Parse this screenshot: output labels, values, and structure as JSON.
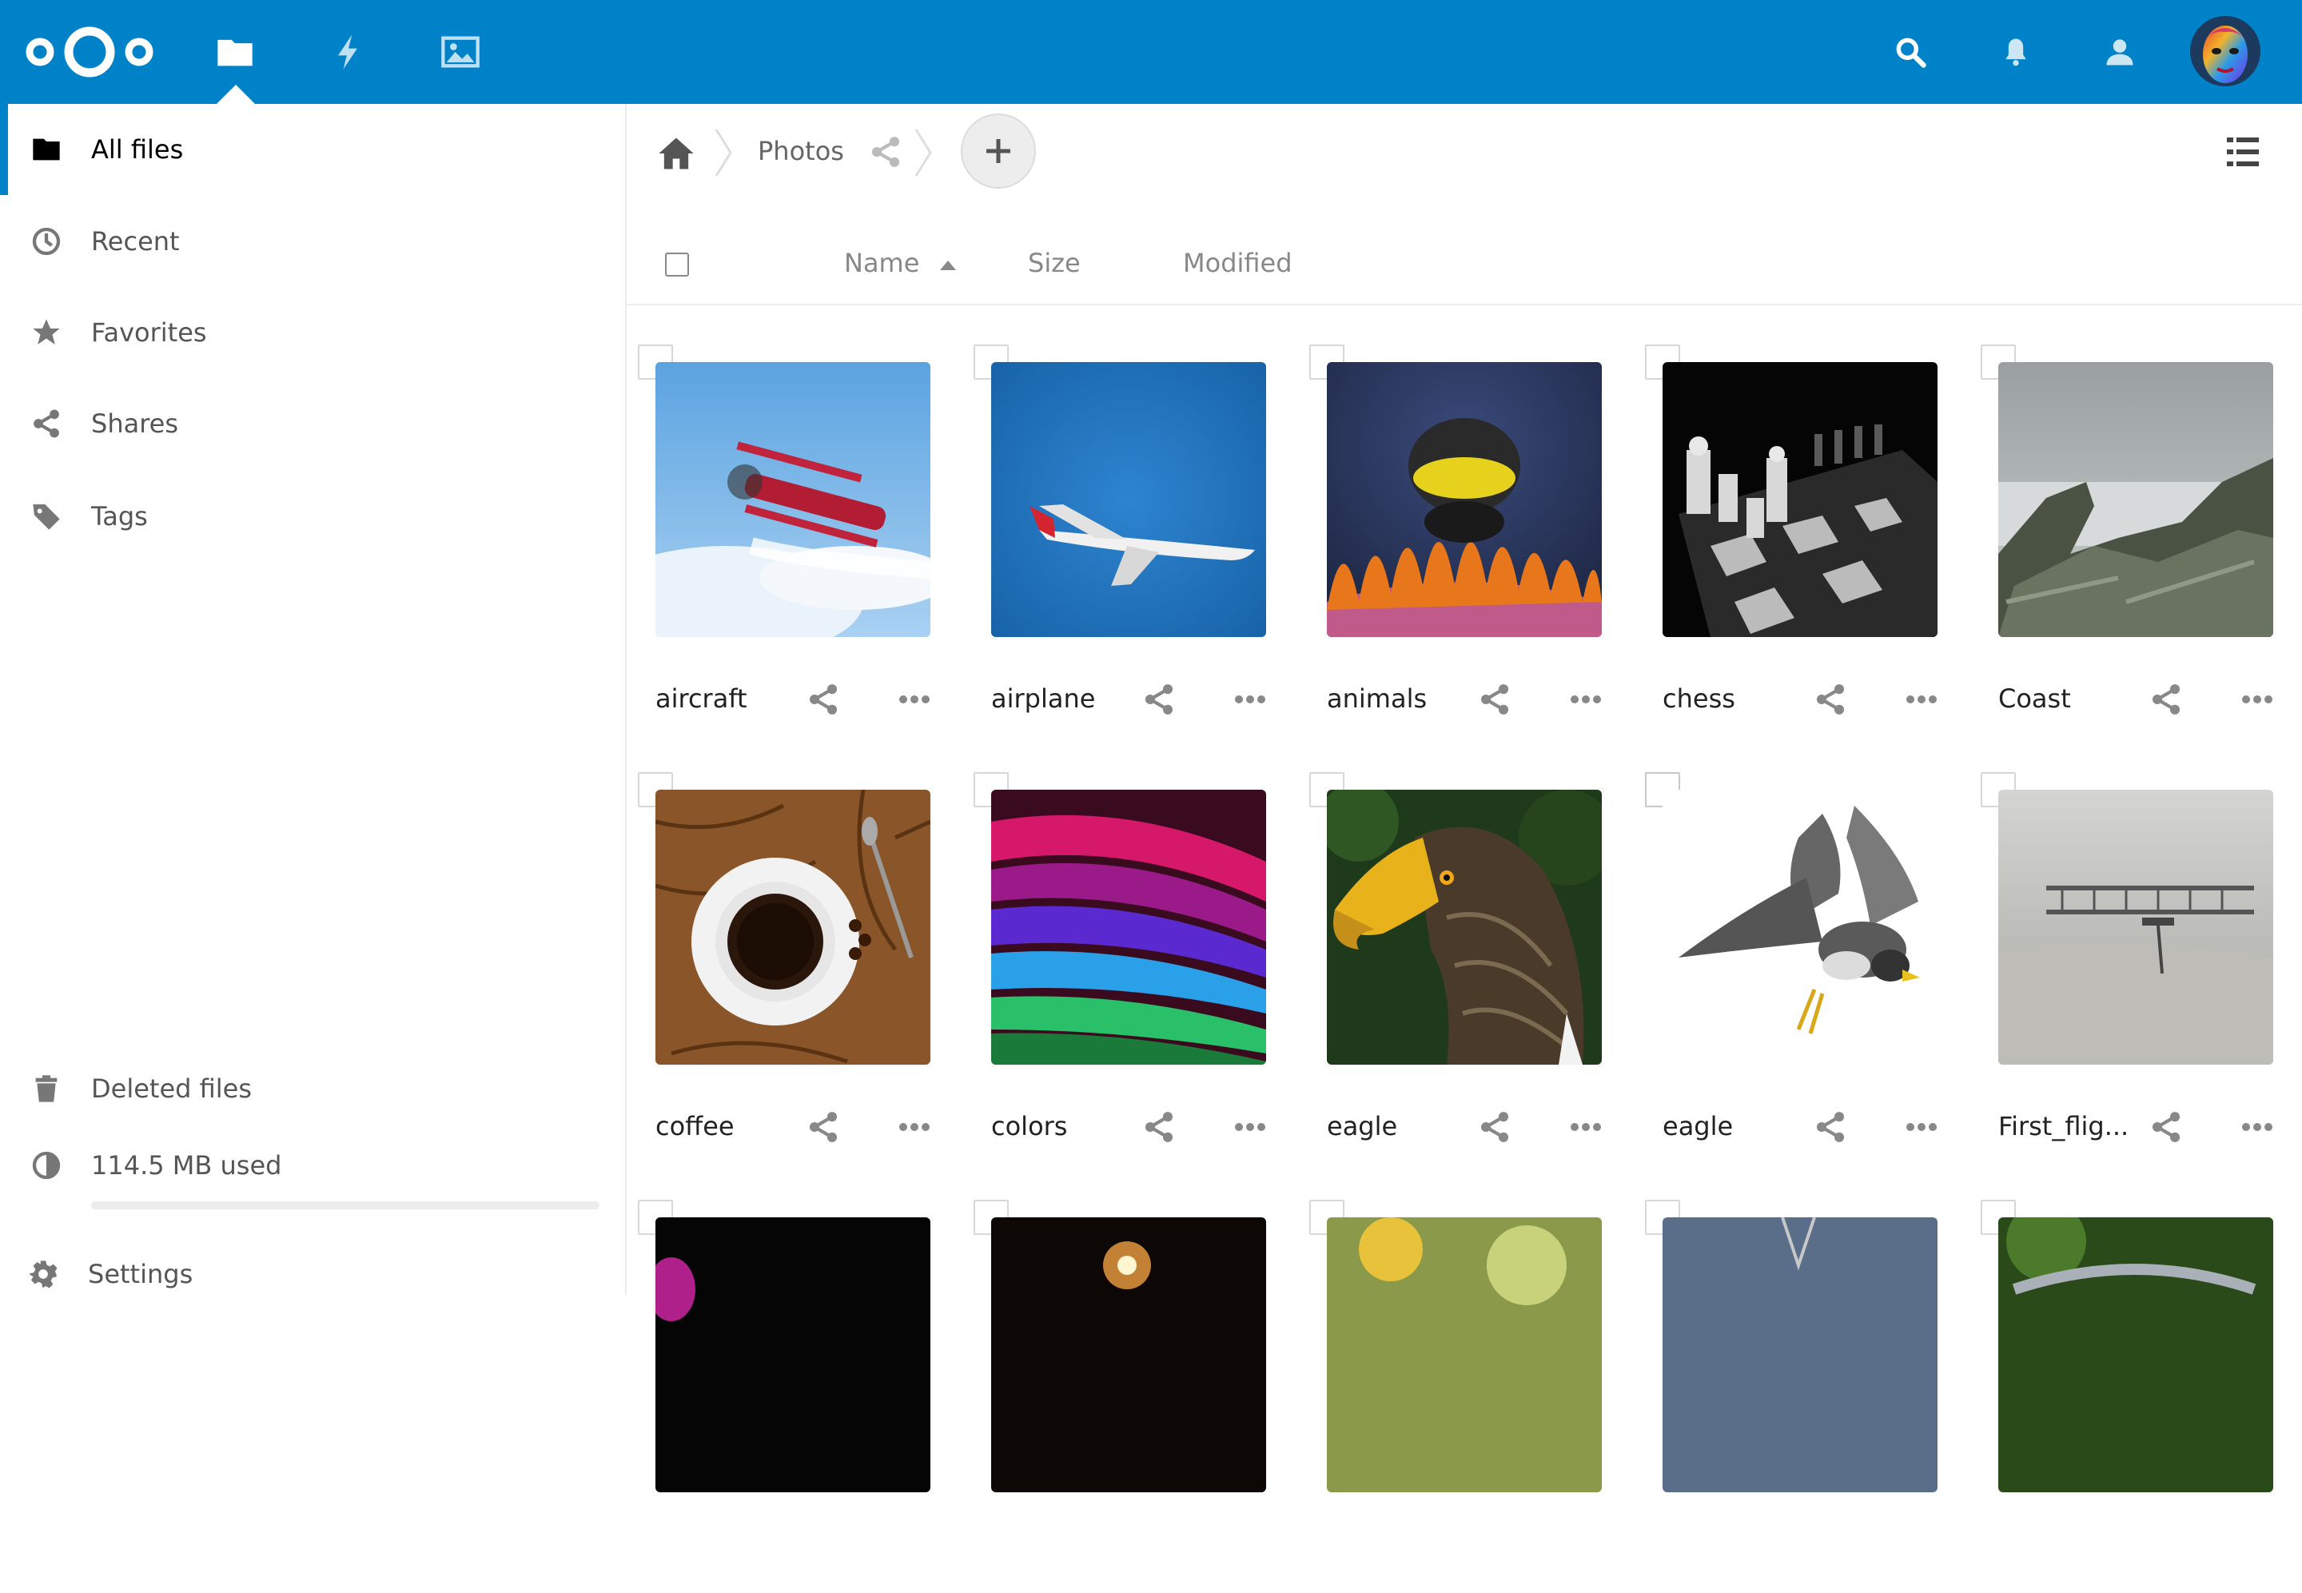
{
  "topbar": {
    "brand_color": "#0082c9",
    "apps": [
      {
        "icon": "folder-icon",
        "name": "Files",
        "active": true
      },
      {
        "icon": "activity-bolt-icon",
        "name": "Activity"
      },
      {
        "icon": "gallery-image-icon",
        "name": "Gallery"
      }
    ],
    "right_icons": [
      "search-icon",
      "notifications-bell-icon",
      "contacts-icon"
    ]
  },
  "sidebar": {
    "items": [
      {
        "label": "All files",
        "icon": "folder-icon"
      },
      {
        "label": "Recent",
        "icon": "clock-icon"
      },
      {
        "label": "Favorites",
        "icon": "star-icon"
      },
      {
        "label": "Shares",
        "icon": "share-icon"
      },
      {
        "label": "Tags",
        "icon": "tag-icon"
      }
    ],
    "deleted_label": "Deleted files",
    "quota_label": "114.5 MB used",
    "quota_fraction": 0.0,
    "settings_label": "Settings"
  },
  "breadcrumb": {
    "current": "Photos"
  },
  "columns": {
    "name": "Name",
    "size": "Size",
    "modified": "Modified"
  },
  "files": [
    {
      "name": "aircraft"
    },
    {
      "name": "airplane"
    },
    {
      "name": "animals"
    },
    {
      "name": "chess"
    },
    {
      "name": "Coast"
    },
    {
      "name": "coffee"
    },
    {
      "name": "colors"
    },
    {
      "name": "eagle"
    },
    {
      "name": "eagle"
    },
    {
      "name": "First_flig..."
    }
  ]
}
